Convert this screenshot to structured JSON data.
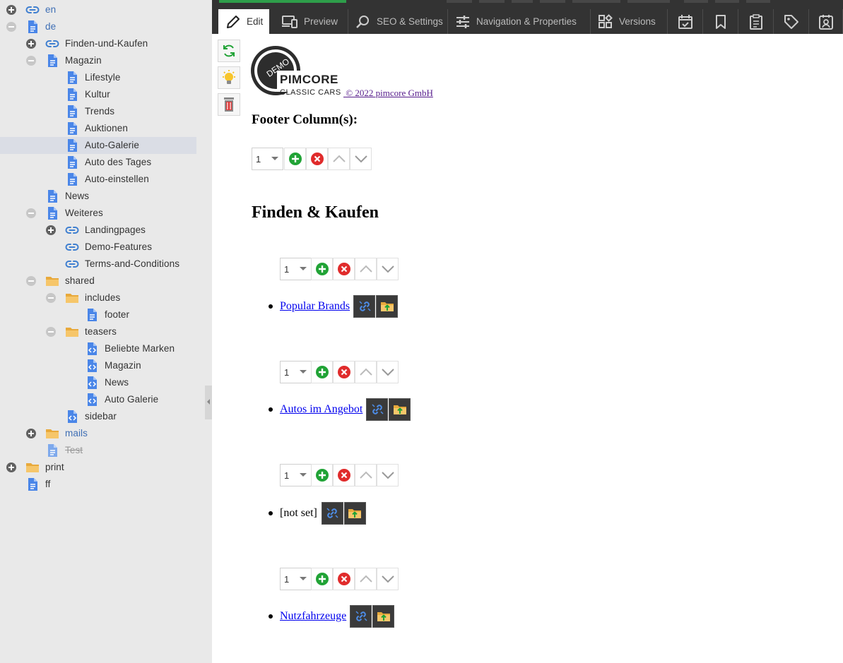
{
  "tree": {
    "items": [
      {
        "label": "en",
        "style": "blue"
      },
      {
        "label": "de",
        "style": "blue"
      },
      {
        "label": "Finden-und-Kaufen",
        "style": "normal"
      },
      {
        "label": "Magazin",
        "style": "normal"
      },
      {
        "label": "Lifestyle",
        "style": "normal"
      },
      {
        "label": "Kultur",
        "style": "normal"
      },
      {
        "label": "Trends",
        "style": "normal"
      },
      {
        "label": "Auktionen",
        "style": "normal"
      },
      {
        "label": "Auto-Galerie",
        "style": "normal",
        "selected": true
      },
      {
        "label": "Auto des Tages",
        "style": "normal"
      },
      {
        "label": "Auto-einstellen",
        "style": "normal"
      },
      {
        "label": "News",
        "style": "normal"
      },
      {
        "label": "Weiteres",
        "style": "normal"
      },
      {
        "label": "Landingpages",
        "style": "normal"
      },
      {
        "label": "Demo-Features",
        "style": "normal"
      },
      {
        "label": "Terms-and-Conditions",
        "style": "normal"
      },
      {
        "label": "shared",
        "style": "normal"
      },
      {
        "label": "includes",
        "style": "normal"
      },
      {
        "label": "footer",
        "style": "normal"
      },
      {
        "label": "teasers",
        "style": "normal"
      },
      {
        "label": "Beliebte Marken",
        "style": "normal"
      },
      {
        "label": "Magazin",
        "style": "normal"
      },
      {
        "label": "News",
        "style": "normal"
      },
      {
        "label": "Auto Galerie",
        "style": "normal"
      },
      {
        "label": "sidebar",
        "style": "normal"
      },
      {
        "label": "mails",
        "style": "blue"
      },
      {
        "label": "Test",
        "style": "strike"
      },
      {
        "label": "print",
        "style": "normal"
      },
      {
        "label": "ff",
        "style": "normal"
      }
    ]
  },
  "tabs": {
    "edit": "Edit",
    "preview": "Preview",
    "seo": "SEO & Settings",
    "navigation": "Navigation & Properties",
    "versions": "Versions"
  },
  "logo": {
    "badge": "DEMO",
    "brand": "PIMCORE",
    "sub": "CLASSIC CARS"
  },
  "content": {
    "copyright": " © 2022 pimcore GmbH",
    "footer_heading": "Footer Column(s):",
    "section_heading": "Finden & Kaufen",
    "footer_block_select": "1",
    "blocks": [
      {
        "select": "1",
        "link": "Popular Brands",
        "is_link": true
      },
      {
        "select": "1",
        "link": "Autos im Angebot",
        "is_link": true
      },
      {
        "select": "1",
        "link": "[not set]",
        "is_link": false
      },
      {
        "select": "1",
        "link": "Nutzfahrzeuge",
        "is_link": true
      }
    ]
  },
  "colors": {
    "sidebar_bg": "#e9e9e9",
    "tabbar_bg": "#333333",
    "accent_green": "#21a336",
    "delete_red": "#e02b2b",
    "link_blue": "#3f6fb5",
    "folder_yellow": "#f4c56a"
  }
}
